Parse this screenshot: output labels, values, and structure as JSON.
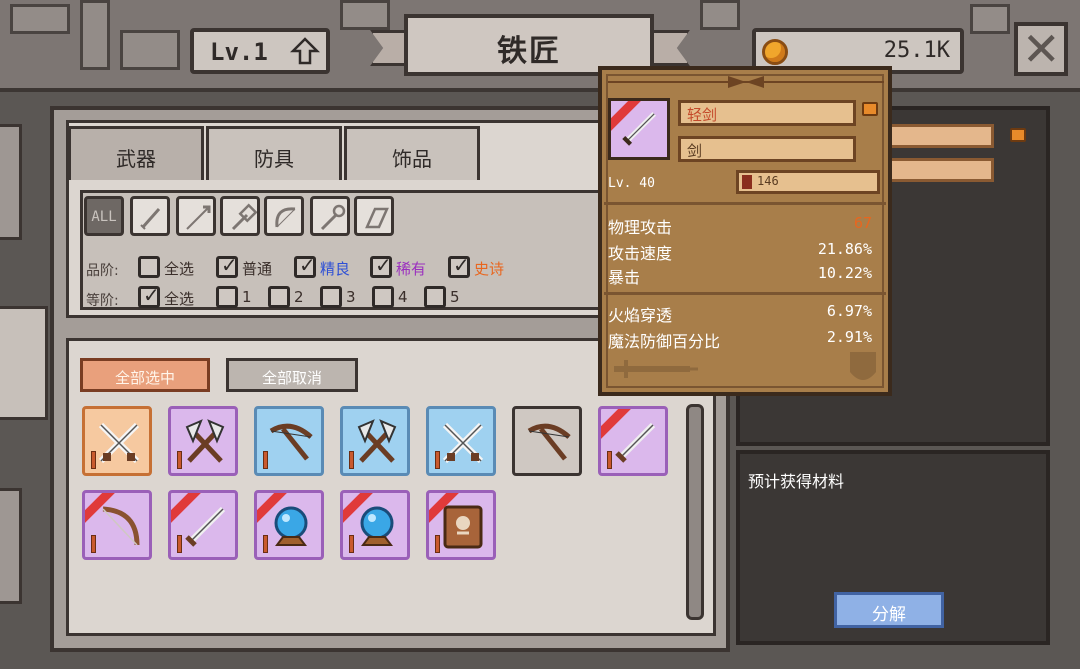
{
  "header": {
    "level_label": "Lv.1",
    "title": "铁匠",
    "gold": "25.1K"
  },
  "tabs": [
    {
      "label": "武器",
      "active": true
    },
    {
      "label": "防具",
      "active": false
    },
    {
      "label": "饰品",
      "active": false
    }
  ],
  "type_filters": [
    {
      "label": "ALL",
      "icon": "all-icon",
      "selected": true
    },
    {
      "icon": "dagger-icon"
    },
    {
      "icon": "spear-icon"
    },
    {
      "icon": "hammer-icon"
    },
    {
      "icon": "bow-icon"
    },
    {
      "icon": "staff-icon"
    },
    {
      "icon": "shield-icon"
    }
  ],
  "quality_filter": {
    "label": "品阶:",
    "options": [
      {
        "label": "全选",
        "checked": false,
        "color": "#2f2a28"
      },
      {
        "label": "普通",
        "checked": true,
        "color": "#2f2a28"
      },
      {
        "label": "精良",
        "checked": true,
        "color": "#2d4fd6"
      },
      {
        "label": "稀有",
        "checked": true,
        "color": "#9b2fbf"
      },
      {
        "label": "史诗",
        "checked": true,
        "color": "#e8661f"
      }
    ]
  },
  "grade_filter": {
    "label": "等阶:",
    "options": [
      {
        "label": "全选",
        "checked": true
      },
      {
        "label": "1",
        "checked": false
      },
      {
        "label": "2",
        "checked": false
      },
      {
        "label": "3",
        "checked": false
      },
      {
        "label": "4",
        "checked": false
      },
      {
        "label": "5",
        "checked": false
      }
    ]
  },
  "buttons": {
    "select_all": "全部选中",
    "deselect_all": "全部取消",
    "decompose": "分解"
  },
  "inventory": [
    {
      "icon": "crossed-swords-icon",
      "rarity": "orange",
      "new": false
    },
    {
      "icon": "crossed-axes-icon",
      "rarity": "purple",
      "new": false
    },
    {
      "icon": "crossbow-icon",
      "rarity": "blue",
      "new": false
    },
    {
      "icon": "crossed-axes-icon",
      "rarity": "blue",
      "new": false
    },
    {
      "icon": "crossed-swords-icon",
      "rarity": "blue",
      "new": false
    },
    {
      "icon": "crossbow-icon",
      "rarity": "common",
      "new": false
    },
    {
      "icon": "sword-icon",
      "rarity": "purple",
      "new": true
    },
    {
      "icon": "bow-icon",
      "rarity": "purple",
      "new": true
    },
    {
      "icon": "sword-icon",
      "rarity": "purple",
      "new": true
    },
    {
      "icon": "orb-icon",
      "rarity": "purple",
      "new": true
    },
    {
      "icon": "orb-icon",
      "rarity": "purple",
      "new": true
    },
    {
      "icon": "spellbook-icon",
      "rarity": "purple",
      "new": true
    }
  ],
  "tooltip": {
    "name": "轻剑",
    "type": "剑",
    "level": "Lv. 40",
    "power": "146",
    "stats": [
      {
        "label": "物理攻击",
        "value": "67",
        "value_color": "#e8661f"
      },
      {
        "label": "攻击速度",
        "value": "21.86%"
      },
      {
        "label": "暴击",
        "value": "10.22%"
      }
    ],
    "bonus_stats": [
      {
        "label": "火焰穿透",
        "value": "6.97%"
      },
      {
        "label": "魔法防御百分比",
        "value": "2.91%"
      }
    ]
  },
  "materials_panel": {
    "title": "预计获得材料"
  },
  "colors": {
    "accent_orange": "#e9a07c",
    "decompose_blue": "#8fb1e6",
    "tooltip_bg": "#a87e4a"
  }
}
